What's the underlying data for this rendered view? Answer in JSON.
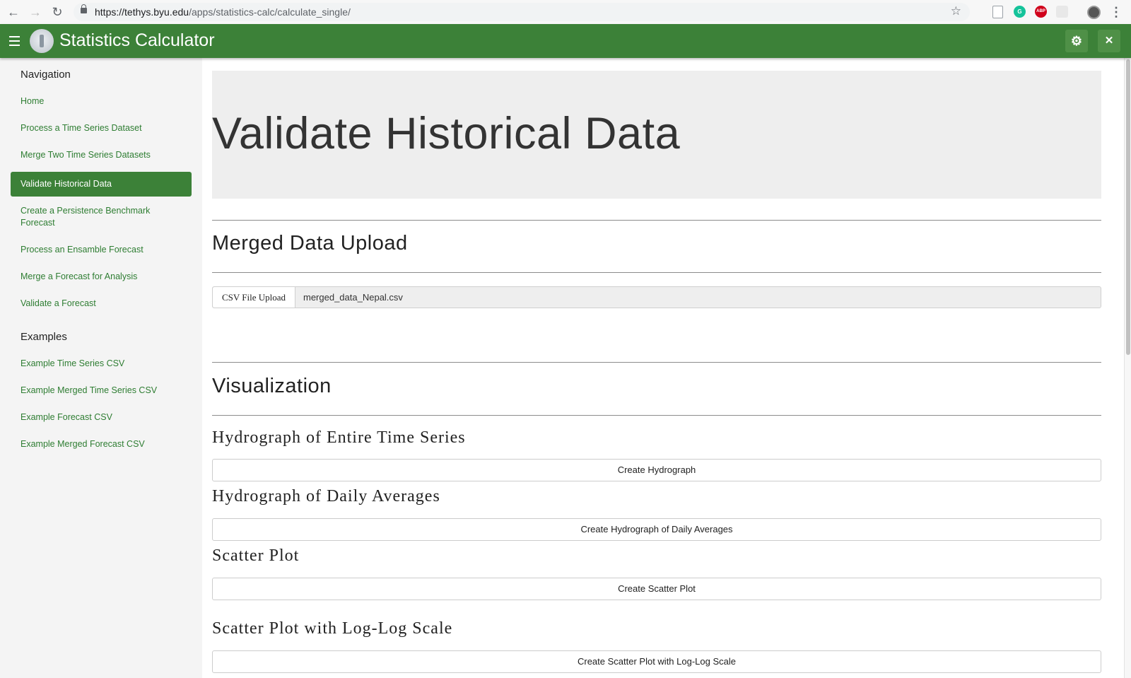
{
  "browser": {
    "url_host": "https://tethys.byu.edu",
    "url_path": "/apps/statistics-calc/calculate_single/",
    "back_glyph": "←",
    "forward_glyph": "→",
    "reload_glyph": "↻",
    "star_glyph": "☆",
    "menu_glyph": "⋮",
    "extensions": [
      "doc-icon",
      "grammarly-icon",
      "adblock-icon",
      "extension-icon",
      "profile-avatar"
    ],
    "abp_label": "ABP",
    "g_label": "G"
  },
  "app": {
    "title": "Statistics Calculator",
    "brand_color": "#3c8138",
    "settings_glyph": "⚙",
    "close_glyph": "✕"
  },
  "sidebar": {
    "navigation_header": "Navigation",
    "nav_items": [
      {
        "label": "Home",
        "active": false
      },
      {
        "label": "Process a Time Series Dataset",
        "active": false
      },
      {
        "label": "Merge Two Time Series Datasets",
        "active": false
      },
      {
        "label": "Validate Historical Data",
        "active": true
      },
      {
        "label": "Create a Persistence Benchmark Forecast",
        "active": false
      },
      {
        "label": "Process an Ensamble Forecast",
        "active": false
      },
      {
        "label": "Merge a Forecast for Analysis",
        "active": false
      },
      {
        "label": "Validate a Forecast",
        "active": false
      }
    ],
    "examples_header": "Examples",
    "example_items": [
      {
        "label": "Example Time Series CSV"
      },
      {
        "label": "Example Merged Time Series CSV"
      },
      {
        "label": "Example Forecast CSV"
      },
      {
        "label": "Example Merged Forecast CSV"
      }
    ]
  },
  "main": {
    "page_title": "Validate Historical Data",
    "upload_section_title": "Merged Data Upload",
    "upload_label": "CSV File Upload",
    "upload_value": "merged_data_Nepal.csv",
    "visualization_title": "Visualization",
    "plots": [
      {
        "heading": "Hydrograph of Entire Time Series",
        "button": "Create Hydrograph"
      },
      {
        "heading": "Hydrograph of Daily Averages",
        "button": "Create Hydrograph of Daily Averages"
      },
      {
        "heading": "Scatter Plot",
        "button": "Create Scatter Plot"
      },
      {
        "heading": "Scatter Plot with Log-Log Scale",
        "button": "Create Scatter Plot with Log-Log Scale"
      }
    ]
  }
}
